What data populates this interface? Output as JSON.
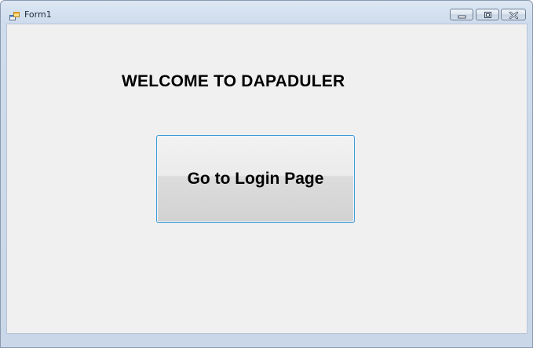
{
  "window": {
    "title": "Form1",
    "icon": "form-app-icon",
    "controls": {
      "minimize_icon": "minimize-icon",
      "maximize_icon": "restore-icon",
      "close_icon": "close-icon"
    },
    "accent_color": "#3c9ad9",
    "client_background": "#f0f0f0"
  },
  "content": {
    "heading": "WELCOME TO DAPADULER",
    "login_button_label": "Go to Login Page"
  }
}
